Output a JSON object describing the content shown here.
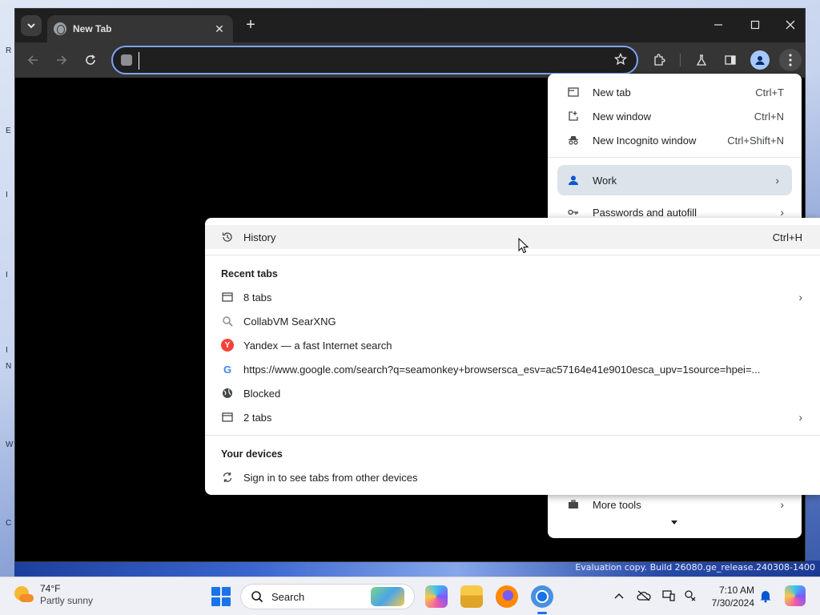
{
  "tab": {
    "title": "New Tab"
  },
  "omnibox": {
    "value": ""
  },
  "main_menu": {
    "items": [
      {
        "label": "New tab",
        "shortcut": "Ctrl+T"
      },
      {
        "label": "New window",
        "shortcut": "Ctrl+N"
      },
      {
        "label": "New Incognito window",
        "shortcut": "Ctrl+Shift+N"
      }
    ],
    "profile": {
      "label": "Work"
    },
    "passwords": {
      "label": "Passwords and autofill"
    },
    "more_tools": {
      "label": "More tools"
    }
  },
  "history_menu": {
    "history": {
      "label": "History",
      "shortcut": "Ctrl+H"
    },
    "recent_tabs_heading": "Recent tabs",
    "recent_tabs": [
      {
        "label": "8 tabs",
        "icon": "window-icon",
        "submenu": true
      },
      {
        "label": "CollabVM SearXNG",
        "icon": "searxng-icon",
        "submenu": false
      },
      {
        "label": "Yandex — a fast Internet search",
        "icon": "yandex-icon",
        "submenu": false
      },
      {
        "label": "https://www.google.com/search?q=seamonkey+browsersca_esv=ac57164e41e9010esca_upv=1source=hpei=...",
        "icon": "google-icon",
        "submenu": false
      },
      {
        "label": "Blocked",
        "icon": "globe-icon",
        "submenu": false
      },
      {
        "label": "2 tabs",
        "icon": "window-icon",
        "submenu": true
      }
    ],
    "devices_heading": "Your devices",
    "sign_in": {
      "label": "Sign in to see tabs from other devices"
    }
  },
  "desktop": {
    "evaluation_text": "Evaluation copy. Build 26080.ge_release.240308-1400",
    "edge_letters": [
      "R",
      "E",
      "I",
      "I",
      "I",
      "N",
      "W",
      "C"
    ]
  },
  "taskbar": {
    "weather": {
      "temp": "74°F",
      "condition": "Partly sunny"
    },
    "search": {
      "label": "Search"
    },
    "clock": {
      "time": "7:10 AM",
      "date": "7/30/2024"
    }
  },
  "colors": {
    "accent": "#7ca4f4",
    "profile_highlight": "#dde3ea",
    "dark_chrome": "#353535"
  }
}
